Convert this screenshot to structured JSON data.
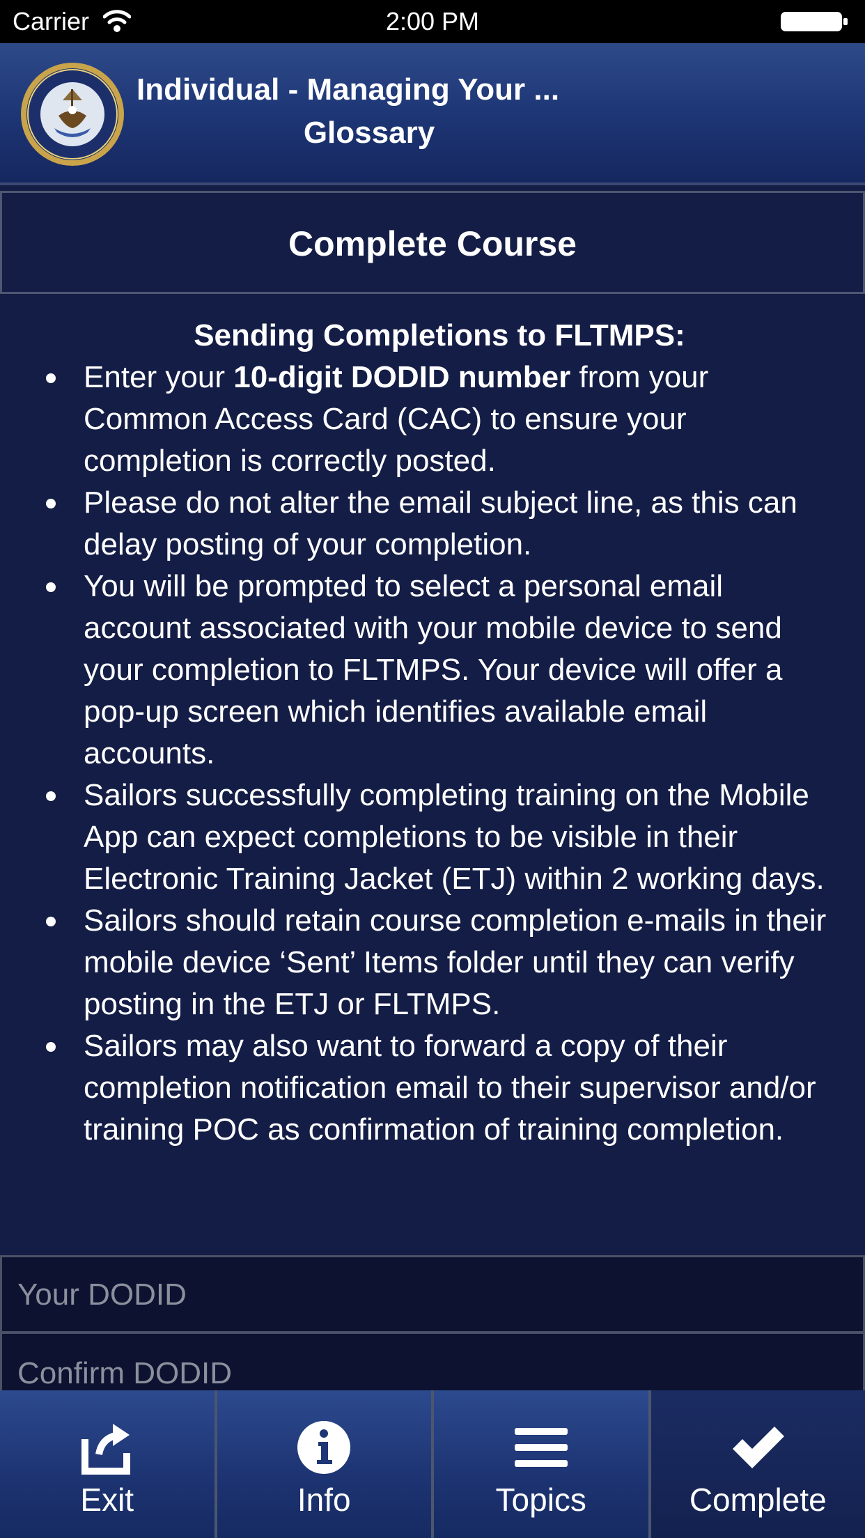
{
  "status_bar": {
    "carrier": "Carrier",
    "time": "2:00 PM"
  },
  "header": {
    "title": "Individual - Managing Your ...",
    "subtitle": "Glossary",
    "logo_icon": "navy-seal-icon"
  },
  "banner": {
    "title": "Complete Course"
  },
  "instructions": {
    "heading": "Sending Completions to FLTMPS:",
    "bullets": [
      {
        "before": "Enter your ",
        "bold": "10-digit DODID number",
        "after": " from your Common Access Card (CAC) to ensure your completion is correctly posted."
      },
      {
        "text": "Please do not alter the email subject line, as this can delay posting of your completion."
      },
      {
        "text": "You will be prompted to select a personal email account associated with your mobile device to send your completion to FLTMPS. Your device will offer a pop-up screen which identifies available email accounts."
      },
      {
        "text": "Sailors successfully completing training on the Mobile App can expect completions to be visible in their Electronic Training Jacket (ETJ) within 2 working days."
      },
      {
        "text": "Sailors should retain course completion e-mails in their mobile device ‘Sent’ Items folder until they can verify posting in the ETJ or FLTMPS."
      },
      {
        "text": "Sailors may also want to forward a copy of their completion notification email to their supervisor and/or training POC as confirmation of training completion."
      }
    ]
  },
  "form": {
    "dodid_placeholder": "Your DODID",
    "confirm_placeholder": "Confirm DODID"
  },
  "tabbar": {
    "exit": {
      "label": "Exit",
      "icon": "exit-icon"
    },
    "info": {
      "label": "Info",
      "icon": "info-icon"
    },
    "topics": {
      "label": "Topics",
      "icon": "menu-icon"
    },
    "complete": {
      "label": "Complete",
      "icon": "checkmark-icon"
    }
  },
  "colors": {
    "background": "#141d45",
    "header_top": "#2e4a89",
    "header_bottom": "#15275f",
    "input_background": "#0c1230",
    "placeholder": "#8c8f9c"
  }
}
